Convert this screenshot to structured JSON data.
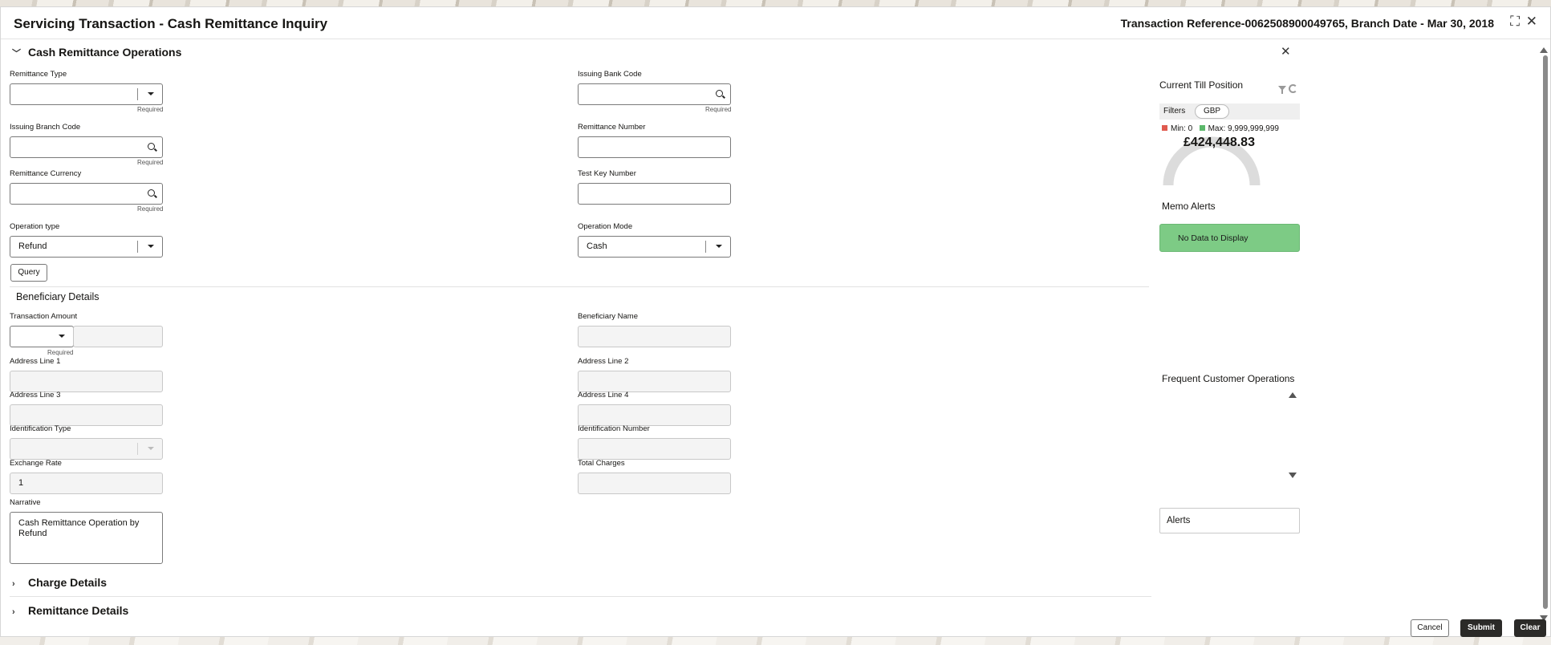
{
  "window": {
    "title": "Servicing Transaction - Cash Remittance Inquiry",
    "transaction_info": "Transaction Reference-0062508900049765, Branch Date - Mar 30, 2018"
  },
  "section_main": {
    "title": "Cash Remittance Operations"
  },
  "labels": {
    "remittance_type": "Remittance Type",
    "issuing_bank_code": "Issuing Bank Code",
    "issuing_branch_code": "Issuing Branch Code",
    "remittance_number": "Remittance Number",
    "remittance_currency": "Remittance Currency",
    "test_key_number": "Test Key Number",
    "operation_type": "Operation type",
    "operation_mode": "Operation Mode",
    "transaction_amount": "Transaction Amount",
    "beneficiary_name": "Beneficiary Name",
    "address_line_1": "Address Line 1",
    "address_line_2": "Address Line 2",
    "address_line_3": "Address Line 3",
    "address_line_4": "Address Line 4",
    "identification_type": "Identification Type",
    "identification_number": "Identification Number",
    "exchange_rate": "Exchange Rate",
    "total_charges": "Total Charges",
    "narrative": "Narrative",
    "required": "Required"
  },
  "values": {
    "operation_type": "Refund",
    "operation_mode": "Cash",
    "exchange_rate": "1",
    "narrative": "Cash Remittance Operation by Refund"
  },
  "buttons": {
    "query": "Query",
    "cancel": "Cancel",
    "submit": "Submit",
    "clear": "Clear"
  },
  "beneficiary_section": {
    "title": "Beneficiary Details"
  },
  "collapsed_sections": {
    "charge_details": "Charge Details",
    "remittance_details": "Remittance Details"
  },
  "till": {
    "title": "Current Till Position",
    "filters_label": "Filters",
    "currency": "GBP",
    "min_label": "Min: 0",
    "max_label": "Max: 9,999,999,999",
    "amount": "£424,448.83",
    "min_color": "#e05a4f",
    "max_color": "#5cb86b"
  },
  "memo_alerts": {
    "title": "Memo Alerts",
    "empty_text": "No Data to Display"
  },
  "frequent_ops": {
    "title": "Frequent Customer Operations"
  },
  "alerts": {
    "label": "Alerts"
  }
}
